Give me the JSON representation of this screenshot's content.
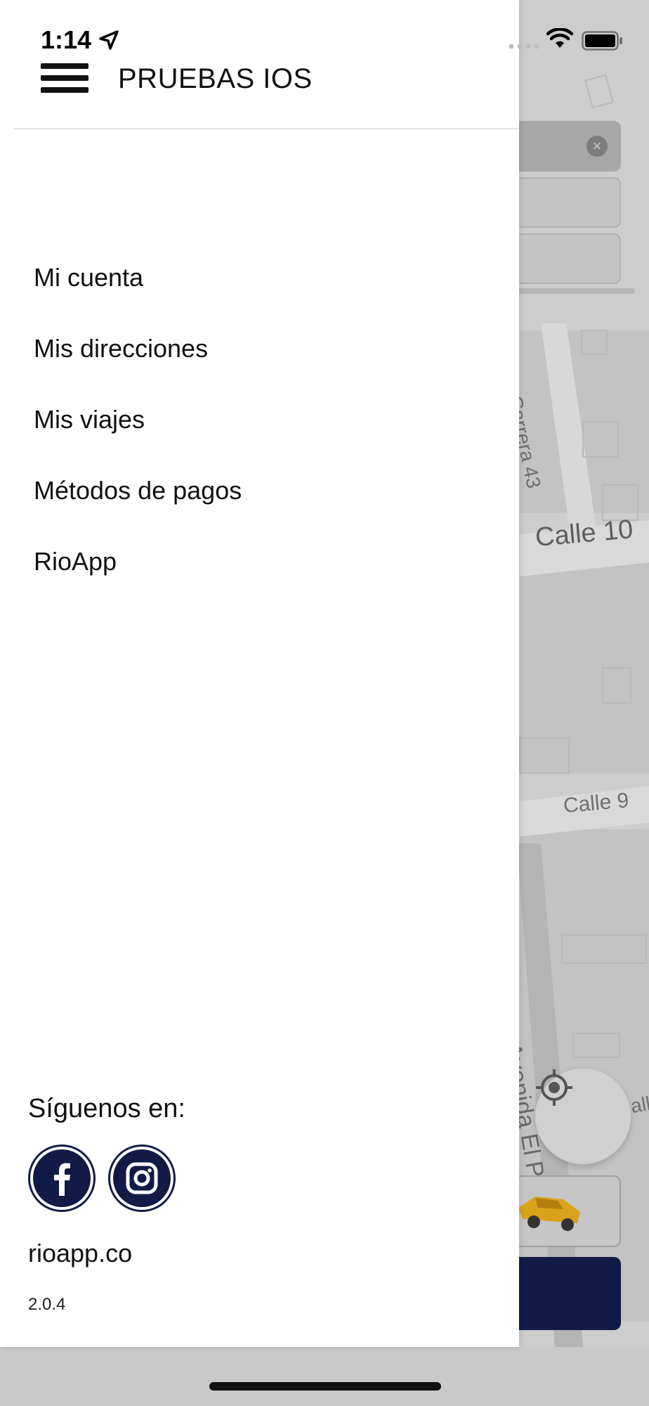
{
  "status_bar": {
    "time": "1:14"
  },
  "header": {
    "title": "PRUEBAS IOS"
  },
  "menu": {
    "items": [
      {
        "label": "Mi cuenta"
      },
      {
        "label": "Mis direcciones"
      },
      {
        "label": "Mis viajes"
      },
      {
        "label": "Métodos de pagos"
      },
      {
        "label": "RioApp"
      }
    ]
  },
  "footer": {
    "follow_label": "Síguenos en:",
    "social": [
      {
        "icon": "facebook-icon"
      },
      {
        "icon": "instagram-icon"
      }
    ],
    "site": "rioapp.co",
    "version": "2.0.4"
  },
  "map": {
    "streets": {
      "carrera": "Carrera 43",
      "calle10": "Calle 10",
      "calle9": "Calle 9",
      "avenida": "Avenida El P",
      "partial": "all"
    }
  },
  "colors": {
    "brand_navy": "#111b45",
    "drawer_bg": "#ffffff",
    "map_bg": "#cdcdcd"
  }
}
